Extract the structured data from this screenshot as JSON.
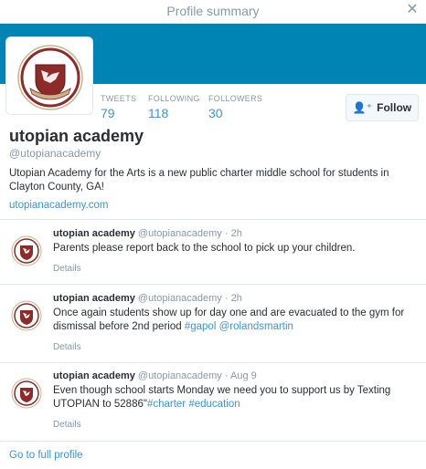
{
  "window": {
    "title": "Profile summary",
    "close_icon": "close-icon"
  },
  "colors": {
    "banner": "#0084b4",
    "link": "#3b94d9",
    "muted": "#8899a6",
    "crest_red": "#8e2a2a"
  },
  "profile": {
    "name": "utopian academy",
    "handle": "@utopianacademy",
    "bio": "Utopian Academy for the Arts is a new public charter middle school for students in Clayton County, GA!",
    "website": "utopianacademy.com",
    "avatar_icon": "school-crest-logo"
  },
  "stats": {
    "tweets_label": "TWEETS",
    "tweets_value": "79",
    "following_label": "FOLLOWING",
    "following_value": "118",
    "followers_label": "FOLLOWERS",
    "followers_value": "30"
  },
  "follow_button": {
    "label": "Follow",
    "icon": "add-user-icon"
  },
  "tweets": [
    {
      "name": "utopian academy",
      "handle": "@utopianacademy",
      "time": "· 2h",
      "text": "Parents please report back to the school to pick up your children.",
      "details": "Details"
    },
    {
      "name": "utopian academy",
      "handle": "@utopianacademy",
      "time": "· 2h",
      "text_plain": "Once again students show up for day one and are evacuated to the gym for dismissal before 2nd period ",
      "hashtag": "#gapol",
      "mention": "@rolandsmartin",
      "details": "Details"
    },
    {
      "name": "utopian academy",
      "handle": "@utopianacademy",
      "time": "· Aug 9",
      "text_plain": "Even though school starts Monday we  need you to support us by Texting UTOPIAN to 52886\"",
      "hashtag1": "#charter",
      "hashtag2": "#education",
      "details": "Details"
    }
  ],
  "footer": {
    "link": "Go to full profile"
  }
}
